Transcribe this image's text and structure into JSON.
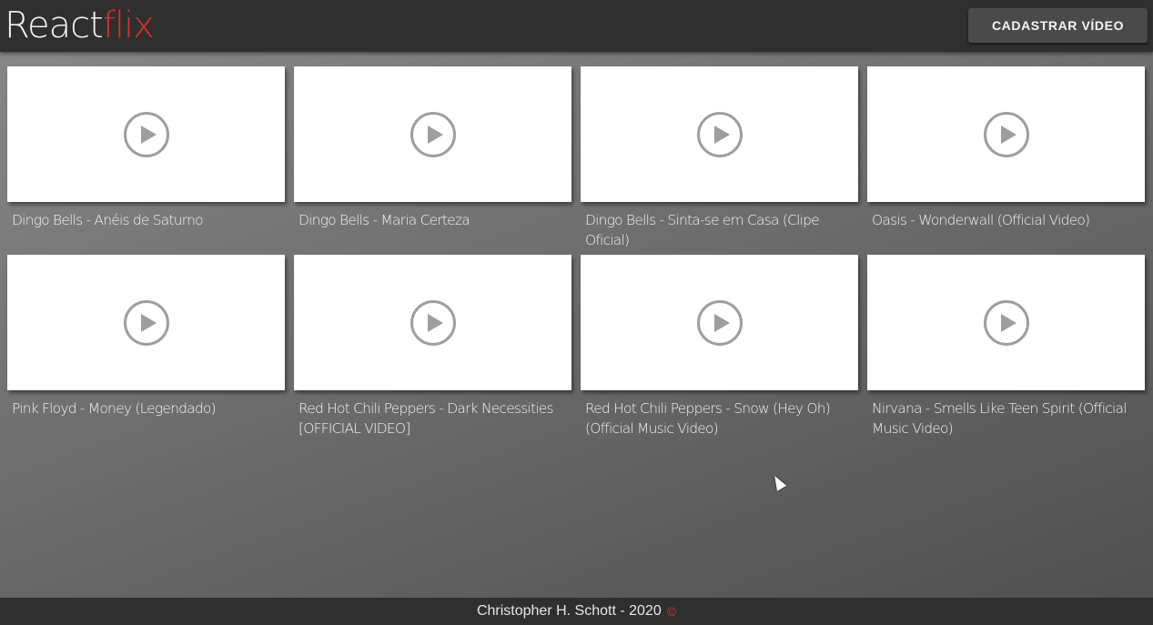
{
  "header": {
    "logo_part1": "React",
    "logo_part2": "flix",
    "cadastrar_label": "CADASTRAR VÍDEO"
  },
  "videos": [
    {
      "title": "Dingo Bells - Anéis de Saturno"
    },
    {
      "title": "Dingo Bells - Maria Certeza"
    },
    {
      "title": "Dingo Bells - Sinta-se em Casa (Clipe Oficial)"
    },
    {
      "title": "Oasis - Wonderwall (Official Video)"
    },
    {
      "title": "Pink Floyd - Money (Legendado)"
    },
    {
      "title": "Red Hot Chili Peppers - Dark Necessities [OFFICIAL VIDEO]"
    },
    {
      "title": "Red Hot Chili Peppers - Snow (Hey Oh) (Official Music Video)"
    },
    {
      "title": "Nirvana - Smells Like Teen Spirit (Official Music Video)"
    }
  ],
  "footer": {
    "text": "Christopher H. Schott - 2020",
    "copyright_symbol": "©"
  },
  "colors": {
    "accent": "#d9302b",
    "header_bg": "#2f2f2f",
    "card_bg": "#ffffff",
    "play_icon": "#9e9e9e"
  },
  "icons": {
    "video_thumbnail": "play-circle-icon",
    "cursor": "mouse-pointer-icon"
  }
}
